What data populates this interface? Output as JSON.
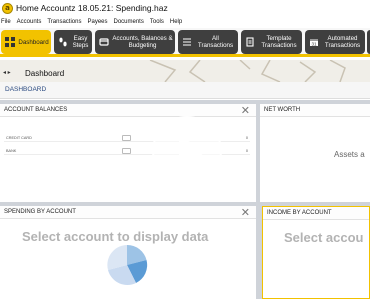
{
  "window": {
    "title": "Home Accountz 18.05.21: Spending.haz",
    "app_icon": "home-accountz-logo-icon",
    "app_icon_letter": "a"
  },
  "menu": [
    "File",
    "Accounts",
    "Transactions",
    "Payees",
    "Documents",
    "Tools",
    "Help"
  ],
  "toolbar": {
    "accent": "#f2c200",
    "button_color": "#3f3f3f",
    "buttons": [
      {
        "label": "Dashboard",
        "icon": "dashboard-grid-icon",
        "active": true
      },
      {
        "label": "Easy Steps",
        "icon": "footsteps-icon",
        "active": false
      },
      {
        "label": "Accounts, Balances & Budgeting",
        "icon": "accounts-icon",
        "active": false
      },
      {
        "label": "All Transactions",
        "icon": "list-icon",
        "active": false
      },
      {
        "label": "Template Transactions",
        "icon": "template-icon",
        "active": false
      },
      {
        "label": "Automated Transactions",
        "icon": "calendar-icon",
        "active": false
      }
    ]
  },
  "page": {
    "title": "Dashboard",
    "breadcrumb": "DASHBOARD"
  },
  "panels": {
    "account_balances": {
      "title": "ACCOUNT BALANCES",
      "rows": [
        {
          "name": "CREDIT CARD",
          "value": "0"
        },
        {
          "name": "BANK",
          "value": "0"
        }
      ]
    },
    "net_worth": {
      "title": "NET WORTH",
      "message": "Assets a"
    },
    "spending_by_account": {
      "title": "SPENDING BY ACCOUNT",
      "message": "Select account to display data",
      "pie_colors": [
        "#9dc3e6",
        "#5b9bd5",
        "#c9daf0",
        "#dbe6f4"
      ]
    },
    "income_by_account": {
      "title": "INCOME BY ACCOUNT",
      "message": "Select accou"
    }
  },
  "video_overlay": {
    "icon": "play-icon"
  }
}
